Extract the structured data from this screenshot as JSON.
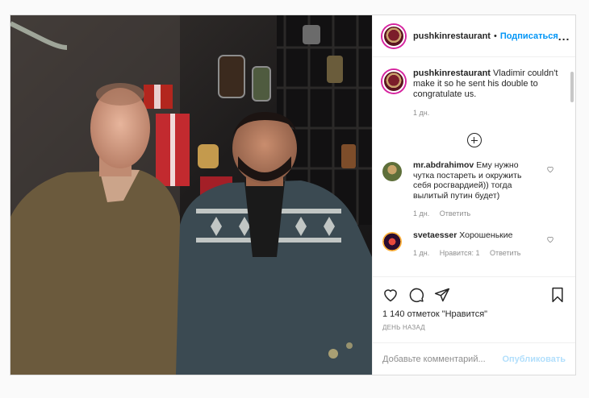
{
  "header": {
    "username": "pushkinrestaurant",
    "separator": "•",
    "follow_label": "Подписаться",
    "more_label": "..."
  },
  "caption": {
    "username": "pushkinrestaurant",
    "text": "Vladimir couldn't make it so he sent his double to congratulate us.",
    "time": "1 дн."
  },
  "comments": [
    {
      "username": "mr.abdrahimov",
      "text": "Ему нужно чутка постареть и окружить себя росгвардией)) тогда вылитый путин будет)",
      "time": "1 дн.",
      "likes": "",
      "reply_label": "Ответить"
    },
    {
      "username": "svetaesser",
      "text": "Хорошенькие",
      "time": "1 дн.",
      "likes": "Нравится: 1",
      "reply_label": "Ответить"
    }
  ],
  "stats": {
    "likes_text": "1 140 отметок \"Нравится\"",
    "posted_ago": "ДЕНЬ НАЗАД"
  },
  "add_comment": {
    "placeholder": "Добавьте комментарий...",
    "post_label": "Опубликовать"
  },
  "icons": {
    "like": "heart-icon",
    "comment": "comment-icon",
    "share": "share-icon",
    "save": "bookmark-icon",
    "load_more": "plus-circle-icon"
  },
  "colors": {
    "accent": "#0095f6",
    "post_disabled": "#b2dffc",
    "muted": "#8e8e8e"
  }
}
